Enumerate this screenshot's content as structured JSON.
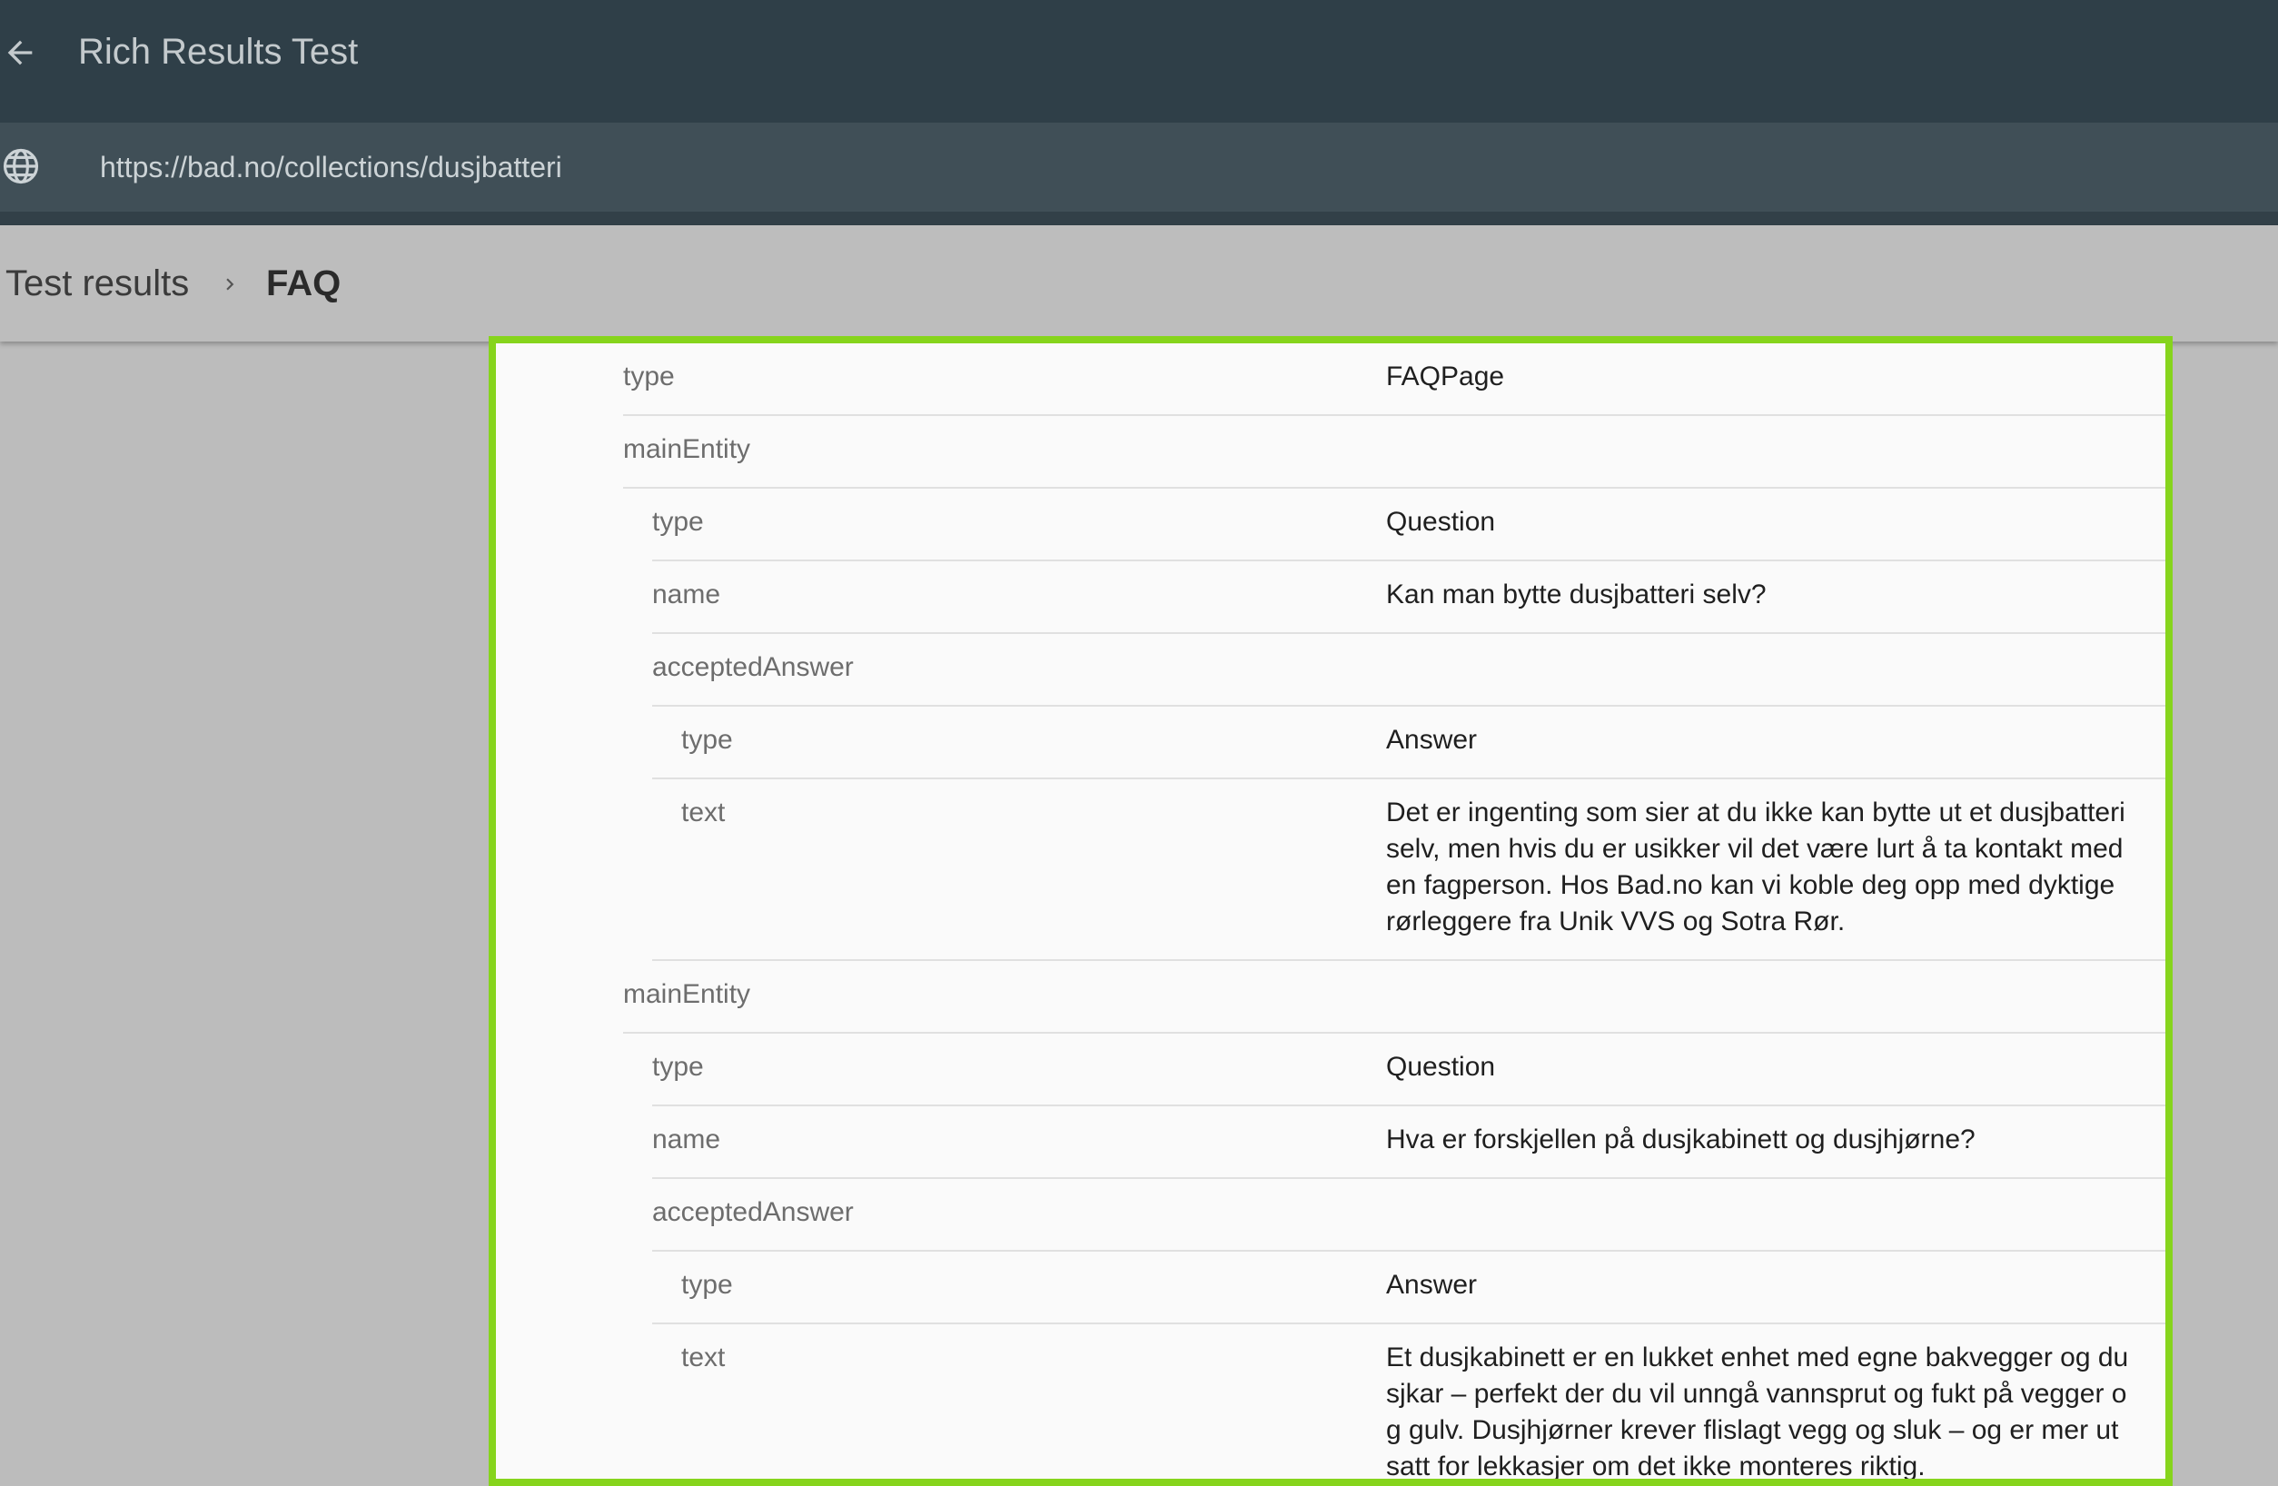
{
  "header": {
    "title": "Rich Results Test",
    "url": "https://bad.no/collections/dusjbatteri"
  },
  "breadcrumb": {
    "root": "Test results",
    "current": "FAQ"
  },
  "rows": [
    {
      "prop": "type",
      "value": "FAQPage",
      "level": 0
    },
    {
      "prop": "mainEntity",
      "value": "",
      "level": 0
    },
    {
      "prop": "type",
      "value": "Question",
      "level": 1
    },
    {
      "prop": "name",
      "value": "Kan man bytte dusjbatteri selv?",
      "level": 1
    },
    {
      "prop": "acceptedAnswer",
      "value": "",
      "level": 1
    },
    {
      "prop": "type",
      "value": "Answer",
      "level": 2
    },
    {
      "prop": "text",
      "value": "Det er ingenting som sier at du ikke kan bytte ut et dusjbatteri selv, men hvis du er usikker vil det være lurt å ta kontakt med en fagperson. Hos Bad.no kan vi koble deg opp med dyktige rørleggere fra Unik VVS og Sotra Rør.",
      "level": 2
    },
    {
      "prop": "mainEntity",
      "value": "",
      "level": 0
    },
    {
      "prop": "type",
      "value": "Question",
      "level": 1
    },
    {
      "prop": "name",
      "value": "Hva er forskjellen på dusjkabinett og dusjhjørne?",
      "level": 1
    },
    {
      "prop": "acceptedAnswer",
      "value": "",
      "level": 1
    },
    {
      "prop": "type",
      "value": "Answer",
      "level": 2
    },
    {
      "prop": "text",
      "value": "Et dusjkabinett er en lukket enhet med egne bakvegger og dusjkar – perfekt der du vil unngå vannsprut og fukt på vegger og gulv. Dusjhjørner krever flislagt vegg og sluk – og er mer utsatt for lekkasjer om det ikke monteres riktig.",
      "level": 2
    }
  ]
}
